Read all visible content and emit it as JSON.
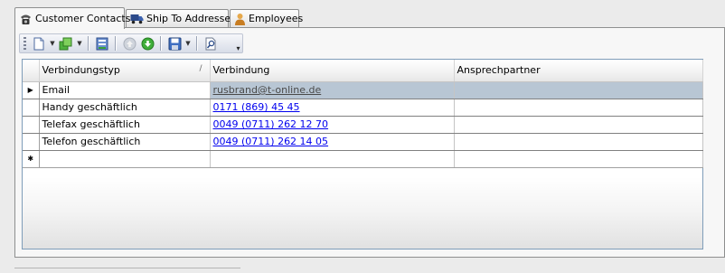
{
  "tabs": [
    {
      "label": "Customer Contacts",
      "icon": "telephone-icon",
      "active": true
    },
    {
      "label": "Ship To Addresses",
      "icon": "truck-icon",
      "active": false
    },
    {
      "label": "Employees",
      "icon": "person-icon",
      "active": false
    }
  ],
  "toolbar": {
    "buttons": [
      "new-document-icon",
      "add-green-icon",
      "save-records-icon",
      "navigate-up-icon",
      "navigate-down-icon",
      "floppy-save-icon",
      "find-icon"
    ]
  },
  "grid": {
    "columns": [
      "Verbindungstyp",
      "Verbindung",
      "Ansprechpartner"
    ],
    "rows": [
      {
        "type": "Email",
        "value": "rusbrand@t-online.de",
        "contact": ""
      },
      {
        "type": "Handy geschäftlich",
        "value": "0171 (869) 45 45",
        "contact": ""
      },
      {
        "type": "Telefax geschäftlich",
        "value": "0049 (0711) 262 12 70",
        "contact": ""
      },
      {
        "type": "Telefon geschäftlich",
        "value": "0049 (0711) 262 14 05",
        "contact": ""
      }
    ],
    "current_row_marker": "▶",
    "new_row_marker": "✱",
    "sort_glyph": "/"
  }
}
